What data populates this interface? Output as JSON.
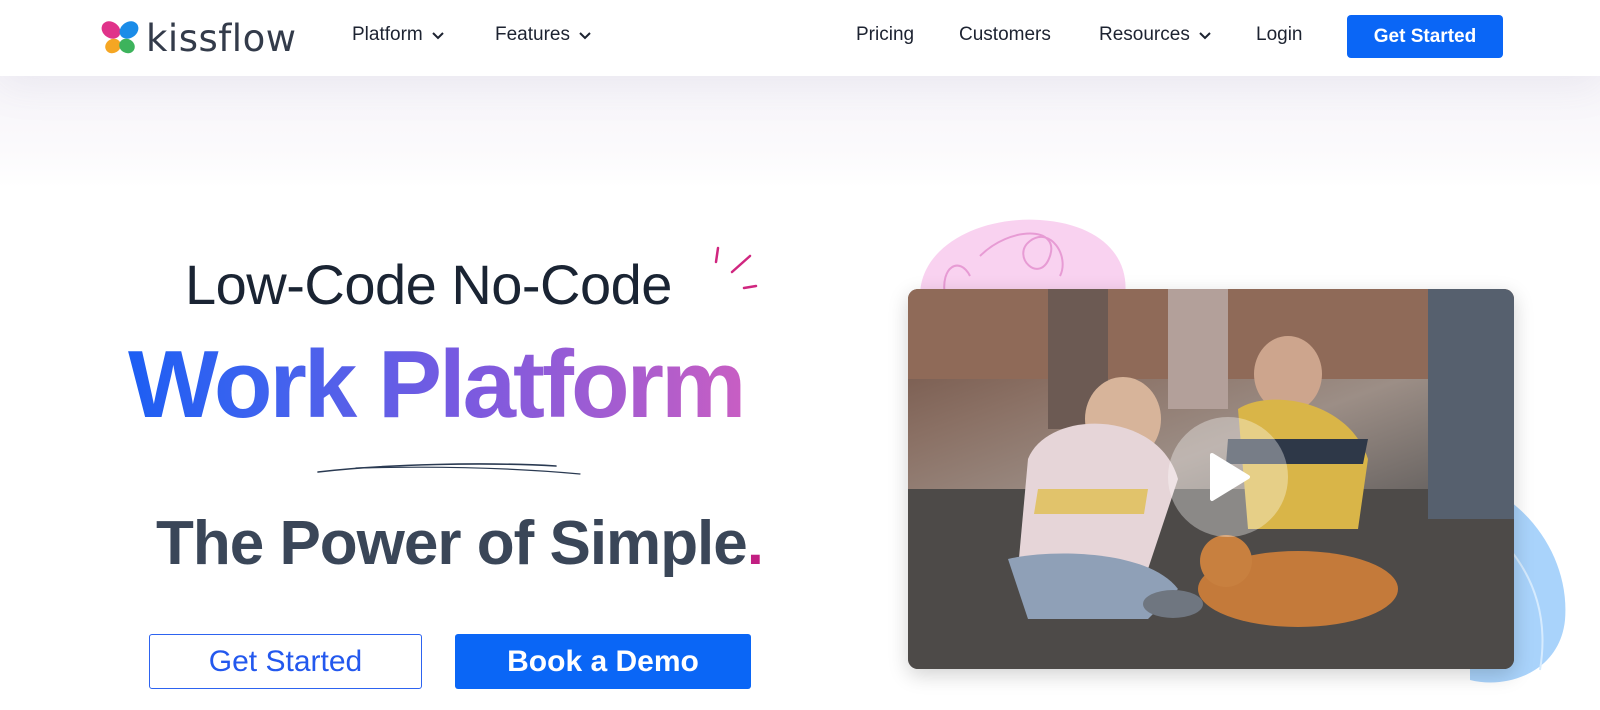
{
  "brand": {
    "name": "kissflow"
  },
  "nav": {
    "left_items": [
      {
        "label": "Platform",
        "has_dropdown": true
      },
      {
        "label": "Features",
        "has_dropdown": true
      }
    ],
    "right_items": [
      {
        "label": "Pricing"
      },
      {
        "label": "Customers"
      },
      {
        "label": "Resources",
        "has_dropdown": true
      },
      {
        "label": "Login"
      }
    ],
    "cta_label": "Get Started"
  },
  "hero": {
    "subheading": "Low-Code No-Code",
    "heading": "Work Platform",
    "tagline": "The Power of Simple",
    "tagline_punct": ".",
    "primary_button": "Get Started",
    "secondary_button": "Book a Demo"
  },
  "video": {
    "icon": "play-icon"
  },
  "colors": {
    "brand_blue": "#0a66f6",
    "gradient_start": "#1d5ef3",
    "gradient_end": "#c85ec3",
    "tagline": "#3a4658",
    "accent_pink": "#c21f82"
  }
}
